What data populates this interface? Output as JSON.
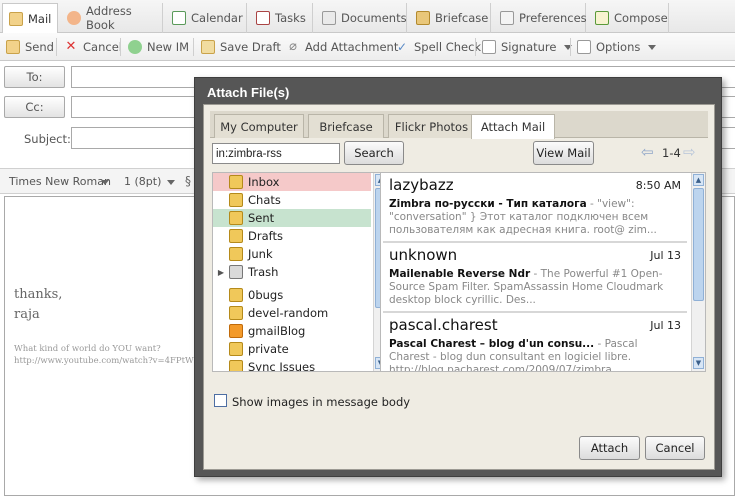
{
  "apptabs": [
    {
      "label": "Mail",
      "icon": "mail-icon",
      "active": true
    },
    {
      "label": "Address Book",
      "icon": "address-book-icon"
    },
    {
      "label": "Calendar",
      "icon": "calendar-icon"
    },
    {
      "label": "Tasks",
      "icon": "tasks-icon"
    },
    {
      "label": "Documents",
      "icon": "documents-icon"
    },
    {
      "label": "Briefcase",
      "icon": "briefcase-icon"
    },
    {
      "label": "Preferences",
      "icon": "preferences-icon"
    },
    {
      "label": "Compose",
      "icon": "compose-icon"
    }
  ],
  "toolbar": {
    "send": "Send",
    "cancel": "Cancel",
    "new_im": "New IM",
    "save_draft": "Save Draft",
    "add_attachment": "Add Attachment",
    "spell_check": "Spell Check",
    "signature": "Signature",
    "options": "Options"
  },
  "compose": {
    "to_label": "To:",
    "cc_label": "Cc:",
    "subject_label": "Subject:",
    "font_family": "Times New Roman",
    "font_size": "1 (8pt)",
    "body_thanks": "thanks,",
    "body_name": "raja",
    "sig_line1": "What kind of world do YOU want?",
    "sig_line2": "http://www.youtube.com/watch?v=4FPtW9j"
  },
  "dialog": {
    "title": "Attach File(s)",
    "tabs": [
      "My Computer",
      "Briefcase",
      "Flickr Photos",
      "Attach Mail"
    ],
    "active_tab": "Attach Mail",
    "search_value": "in:zimbra-rss",
    "search_button": "Search",
    "view_mail_button": "View Mail",
    "pager": "1-4",
    "folders": [
      {
        "name": "Inbox",
        "icon": "inbox-folder-icon"
      },
      {
        "name": "Chats",
        "icon": "chats-folder-icon"
      },
      {
        "name": "Sent",
        "icon": "sent-folder-icon"
      },
      {
        "name": "Drafts",
        "icon": "drafts-folder-icon"
      },
      {
        "name": "Junk",
        "icon": "junk-folder-icon"
      },
      {
        "name": "Trash",
        "icon": "trash-icon"
      },
      {
        "name": "0bugs",
        "icon": "folder-icon"
      },
      {
        "name": "devel-random",
        "icon": "folder-icon"
      },
      {
        "name": "gmailBlog",
        "icon": "rss-folder-icon"
      },
      {
        "name": "private",
        "icon": "folder-icon"
      },
      {
        "name": "Sync Issues",
        "icon": "folder-icon"
      }
    ],
    "messages": [
      {
        "from": "lazybazz",
        "date": "8:50 AM",
        "subject": "Zimbra по-русски - Тип каталога",
        "fragment": " - \"view\": \"conversation\" } Этот каталог подключен всем пользователям как адресная книга. root@ zim..."
      },
      {
        "from": "unknown",
        "date": "Jul 13",
        "subject": "Mailenable Reverse Ndr",
        "fragment": " - The Powerful #1 Open-Source Spam Filter. SpamAssassin Home Cloudmark desktop block cyrillic. Des..."
      },
      {
        "from": "pascal.charest",
        "date": "Jul 13",
        "subject": "Pascal Charest – blog d'un consu...",
        "fragment": " - Pascal Charest - blog dun consultant en logiciel libre. http://blog.pacharest.com/2009/07/zimbra..."
      }
    ],
    "show_images_label": "Show images in message body",
    "attach_button": "Attach",
    "cancel_button": "Cancel"
  }
}
